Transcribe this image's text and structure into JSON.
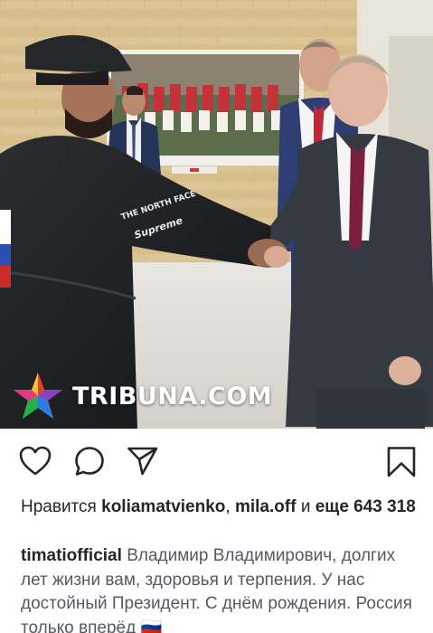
{
  "photo": {
    "watermark": {
      "text": "TRIBUNA.COM",
      "logo": "star-logo"
    },
    "shirt_logos": [
      "THE NORTH FACE",
      "Supreme"
    ]
  },
  "actions": {
    "like_icon": "heart-icon",
    "comment_icon": "comment-bubble-icon",
    "share_icon": "paper-plane-icon",
    "save_icon": "bookmark-icon"
  },
  "likes": {
    "prefix": "Нравится",
    "user1": "koliamatvienko",
    "separator": ",",
    "user2": "mila.off",
    "middle": "и",
    "more_label": "еще",
    "count": "643 318"
  },
  "caption": {
    "username": "timatiofficial",
    "text": "Владимир Владимирович, долгих лет жизни вам, здоровья и терпения. У нас достойный Президент. С днём рождения. Россия только вперёд 🇷🇺"
  },
  "colors": {
    "text": "#262626",
    "caption_text": "#555a60",
    "background": "#ffffff"
  }
}
